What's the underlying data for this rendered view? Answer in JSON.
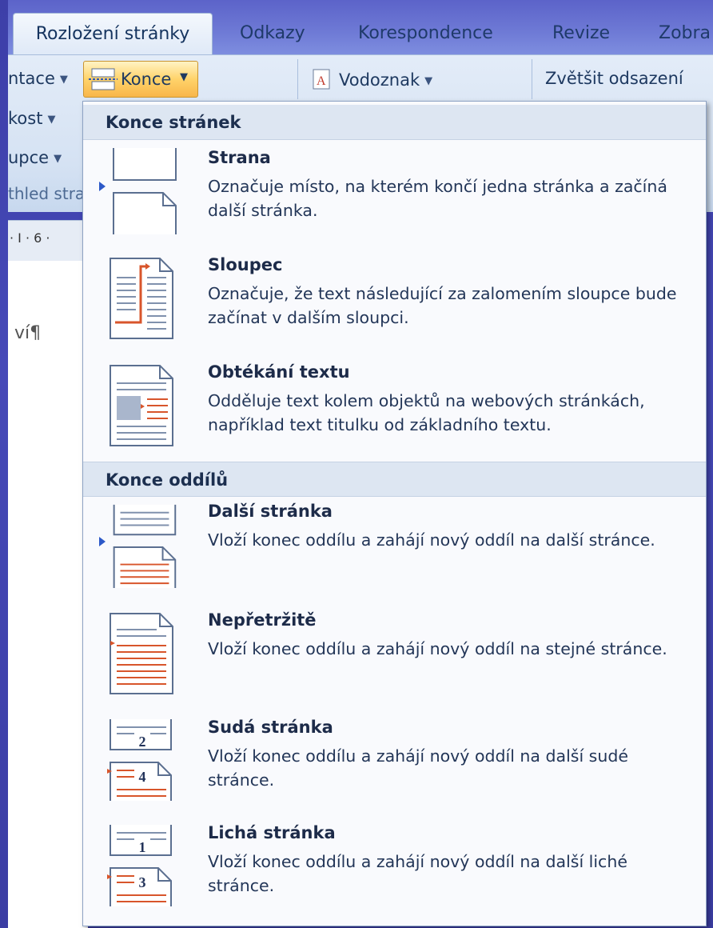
{
  "tabs": [
    {
      "label": "Rozložení stránky",
      "active": true
    },
    {
      "label": "Odkazy"
    },
    {
      "label": "Korespondence"
    },
    {
      "label": "Revize"
    },
    {
      "label": "Zobra"
    }
  ],
  "ribbon": {
    "orientation_label": "ntace",
    "size_label": "kost",
    "columns_label": "upce",
    "konce_label": "Konce",
    "watermark_label": "Vodoznak",
    "indent_label": "Zvětšit odsazení",
    "group_label": "thled stra",
    "ruler_text": "· I · 6 ·"
  },
  "document": {
    "visible_text": "ví¶"
  },
  "menu": {
    "section_page_breaks": "Konce stránek",
    "section_section_breaks": "Konce oddílů",
    "items": [
      {
        "title": "Strana",
        "desc": "Označuje místo, na kterém končí jedna stránka a začíná další stránka."
      },
      {
        "title": "Sloupec",
        "desc": "Označuje, že text následující za zalomením sloupce bude začínat v dalším sloupci."
      },
      {
        "title": "Obtékání textu",
        "desc": "Odděluje text kolem objektů na webových stránkách, například text titulku od základního textu."
      },
      {
        "title": "Další stránka",
        "desc": "Vloží konec oddílu a zahájí nový oddíl na další stránce."
      },
      {
        "title": "Nepřetržitě",
        "desc": "Vloží konec oddílu a zahájí nový oddíl na stejné stránce."
      },
      {
        "title": "Sudá stránka",
        "desc": "Vloží konec oddílu a zahájí nový oddíl na další sudé stránce.",
        "icon_numbers": [
          "2",
          "4"
        ]
      },
      {
        "title": "Lichá stránka",
        "desc": "Vloží konec oddílu a zahájí nový oddíl na další liché stránce.",
        "icon_numbers": [
          "1",
          "3"
        ]
      }
    ]
  }
}
